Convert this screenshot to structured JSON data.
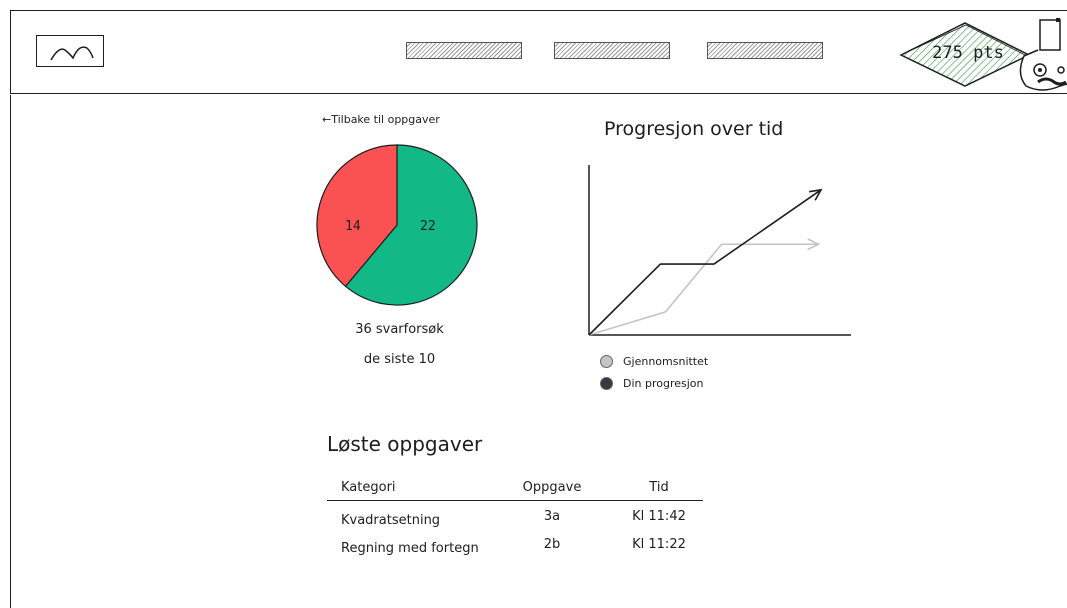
{
  "header": {
    "points": "275 pts",
    "nav": [
      "",
      "",
      ""
    ]
  },
  "main": {
    "back_link": "←Tilbake til oppgaver",
    "pie": {
      "caption_line1": "36 svarforsøk",
      "caption_line2": "de siste 10"
    },
    "progress_title": "Progresjon over tid",
    "legend": [
      {
        "label": "Gjennomsnittet",
        "color": "#c4c4c4"
      },
      {
        "label": "Din progresjon",
        "color": "#343a40"
      }
    ],
    "solved": {
      "title": "Løste oppgaver",
      "columns": [
        "Kategori",
        "Oppgave",
        "Tid"
      ],
      "rows": [
        {
          "category": "Kvadratsetning",
          "task": "3a",
          "time": "Kl 11:42"
        },
        {
          "category": "Regning med fortegn",
          "task": "2b",
          "time": "Kl 11:22"
        }
      ]
    }
  },
  "chart_data": [
    {
      "type": "pie",
      "values": [
        22,
        14
      ],
      "labels": [
        "22",
        "14"
      ],
      "colors": [
        "#12b886",
        "#fa5252"
      ]
    },
    {
      "type": "line",
      "title": "Progresjon over tid",
      "series": [
        {
          "name": "Gjennomsnittet",
          "color": "#c4c4c4",
          "points": [
            [
              0,
              0
            ],
            [
              0.3,
              0.14
            ],
            [
              0.52,
              0.55
            ],
            [
              0.9,
              0.55
            ]
          ]
        },
        {
          "name": "Din progresjon",
          "color": "#1e1e1e",
          "points": [
            [
              0,
              0
            ],
            [
              0.28,
              0.43
            ],
            [
              0.49,
              0.43
            ],
            [
              0.91,
              0.88
            ]
          ]
        }
      ],
      "xlim": [
        0,
        1
      ],
      "ylim": [
        0,
        1
      ],
      "grid": false
    }
  ],
  "colors": {
    "points_badge": "#b2f2bb",
    "pie_green": "#12b886",
    "pie_red": "#fa5252"
  }
}
